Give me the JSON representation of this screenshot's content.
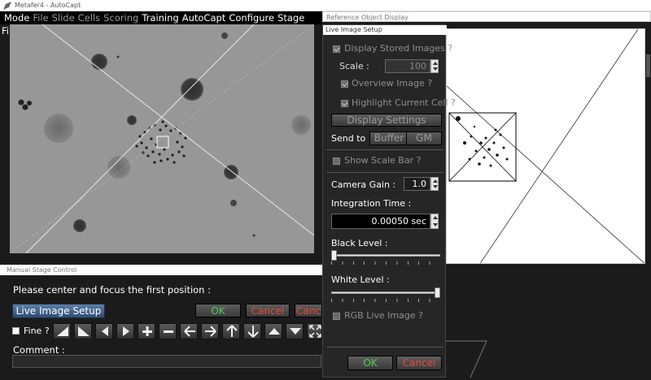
{
  "window": {
    "title": "Metafer4 - AutoCapt"
  },
  "menu": [
    {
      "label": "Mode",
      "enabled": true
    },
    {
      "label": "File",
      "enabled": false
    },
    {
      "label": "Slide",
      "enabled": false
    },
    {
      "label": "Cells",
      "enabled": false
    },
    {
      "label": "Scoring",
      "enabled": false
    },
    {
      "label": "Training",
      "enabled": true
    },
    {
      "label": "AutoCapt",
      "enabled": true
    },
    {
      "label": "Configure",
      "enabled": true
    },
    {
      "label": "Stage",
      "enabled": true
    },
    {
      "label": "Filters",
      "enabled": true
    }
  ],
  "reference_display": {
    "title": "Reference Object Display"
  },
  "manual_stage": {
    "title": "Manual Stage Control",
    "message": "Please center and focus the first position :",
    "live_image_setup_label": "Live Image Setup",
    "ok_label": "OK",
    "cancel_label": "Cancel",
    "cancel2_label": "Canc",
    "fine_label": "Fine ?",
    "comment_label": "Comment :",
    "comment_value": ""
  },
  "live_setup": {
    "title": "Live Image Setup",
    "display_stored_label": "Display Stored Images ?",
    "scale_label": "Scale :",
    "scale_value": "100",
    "overview_label": "Overview Image ?",
    "highlight_label": "Highlight Current Cell ?",
    "display_settings_label": "Display Settings",
    "send_to_label": "Send to :",
    "buffer_label": "Buffer",
    "gm_label": "GM",
    "show_scale_bar_label": "Show Scale Bar ?",
    "camera_gain_label": "Camera Gain :",
    "camera_gain_value": "1.0",
    "integration_time_label": "Integration Time :",
    "integration_time_value": "0.00050 sec",
    "black_level_label": "Black Level :",
    "black_level": 0.0,
    "white_level_label": "White Level :",
    "white_level": 1.0,
    "rgb_live_label": "RGB Live Image ?",
    "ok_label": "OK",
    "cancel_label": "Cancel"
  }
}
